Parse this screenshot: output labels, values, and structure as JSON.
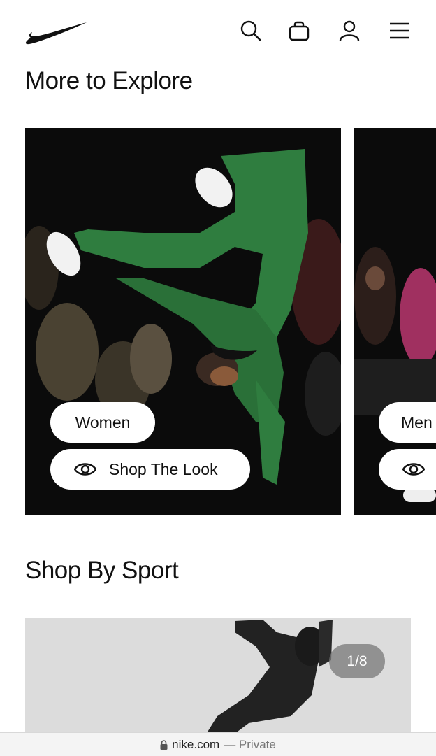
{
  "header": {
    "logo": "nike-swoosh-logo",
    "icons": [
      "search-icon",
      "bag-icon",
      "account-icon",
      "menu-icon"
    ]
  },
  "explore": {
    "title": "More to Explore",
    "cards": [
      {
        "category_label": "Women",
        "shop_look_label": "Shop The Look"
      },
      {
        "category_label": "Men"
      }
    ]
  },
  "sport": {
    "title": "Shop By Sport",
    "counter": "1/8"
  },
  "browser": {
    "domain": "nike.com",
    "mode": "— Private"
  },
  "colors": {
    "accent_green": "#2f7d3f",
    "pill_bg": "#ffffff",
    "card_bg": "#0b0b0b"
  }
}
